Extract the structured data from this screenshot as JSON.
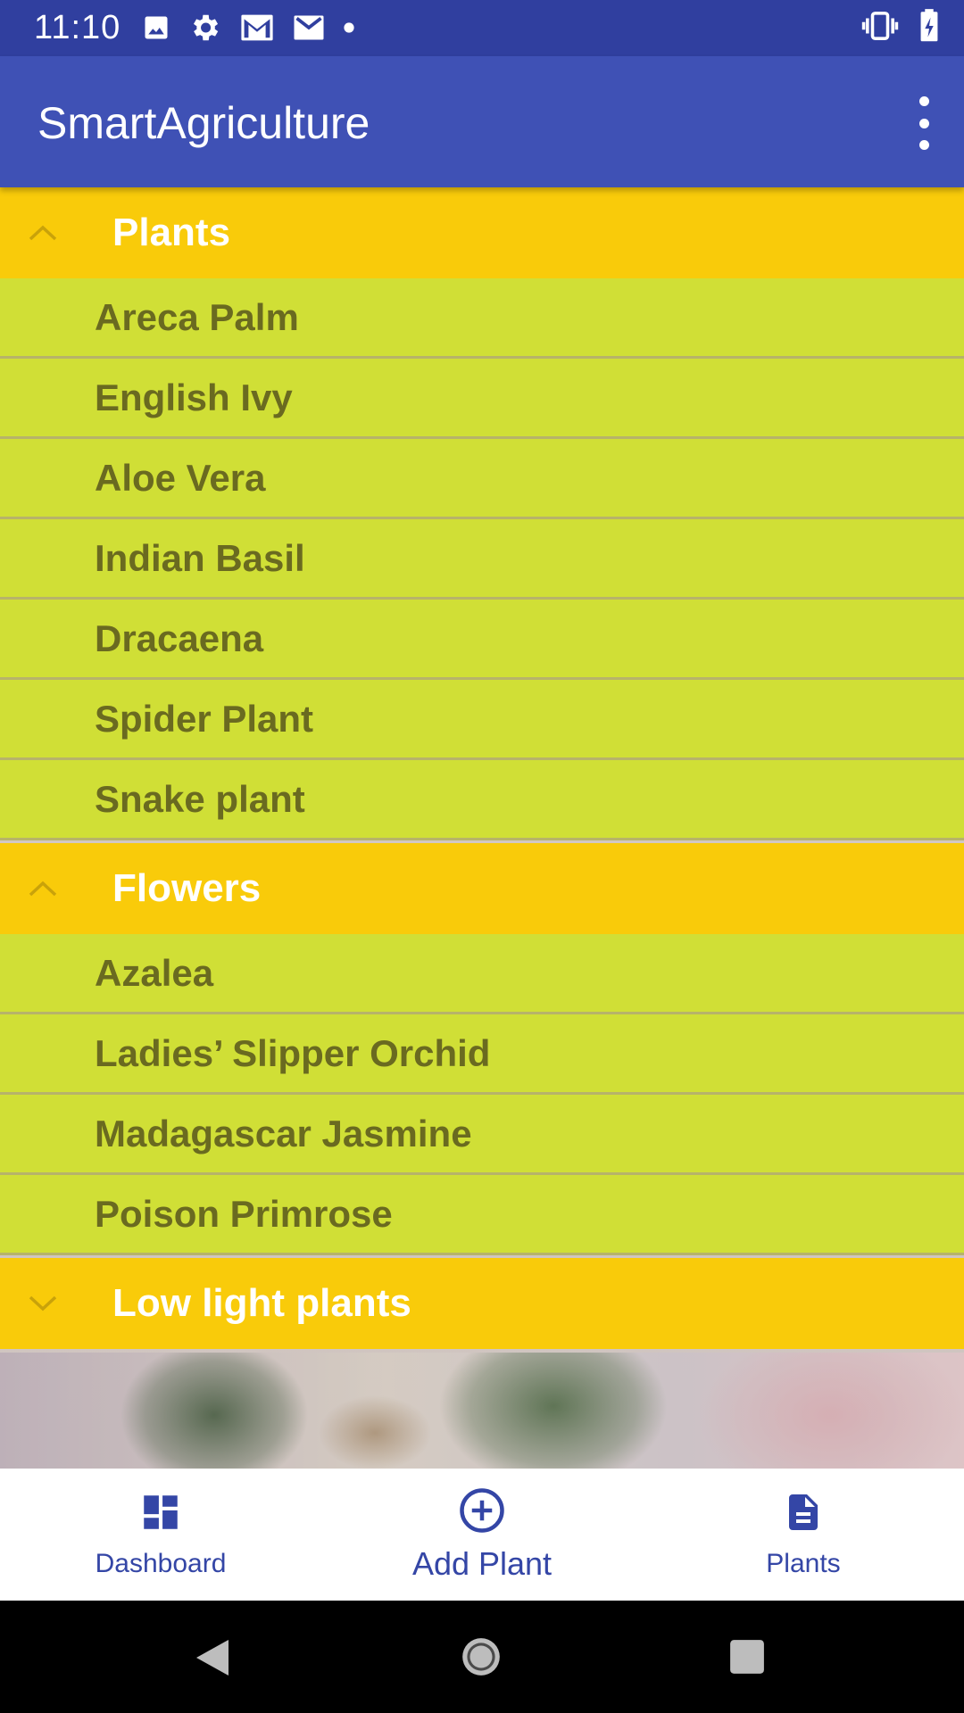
{
  "status_bar": {
    "time": "11:10",
    "left_icons": [
      "image-icon",
      "settings-icon",
      "gmail-icon",
      "gmail-icon",
      "dot-icon"
    ],
    "right_icons": [
      "vibrate-icon",
      "battery-icon"
    ]
  },
  "app_bar": {
    "title": "SmartAgriculture",
    "overflow_icon": "more-vert-icon"
  },
  "groups": [
    {
      "title": "Plants",
      "expanded": true,
      "items": [
        "Areca Palm",
        "English Ivy",
        "Aloe Vera",
        "Indian Basil",
        "Dracaena",
        "Spider Plant",
        "Snake plant"
      ]
    },
    {
      "title": "Flowers",
      "expanded": true,
      "items": [
        "Azalea",
        "Ladies’ Slipper Orchid",
        "Madagascar Jasmine",
        "Poison Primrose"
      ]
    },
    {
      "title": "Low light plants",
      "expanded": false,
      "items": []
    }
  ],
  "bottom_nav": {
    "items": [
      {
        "label": "Dashboard",
        "icon": "dashboard-icon"
      },
      {
        "label": "Add Plant",
        "icon": "add-circle-icon"
      },
      {
        "label": "Plants",
        "icon": "document-icon"
      }
    ]
  },
  "system_nav": [
    "back-icon",
    "home-icon",
    "recents-icon"
  ],
  "colors": {
    "status_bar": "#303f9f",
    "app_bar": "#3f51b5",
    "group_header": "#f9cb0a",
    "child_row": "#d0df36",
    "child_text": "#6a6a20",
    "nav_accent": "#3446a6"
  }
}
